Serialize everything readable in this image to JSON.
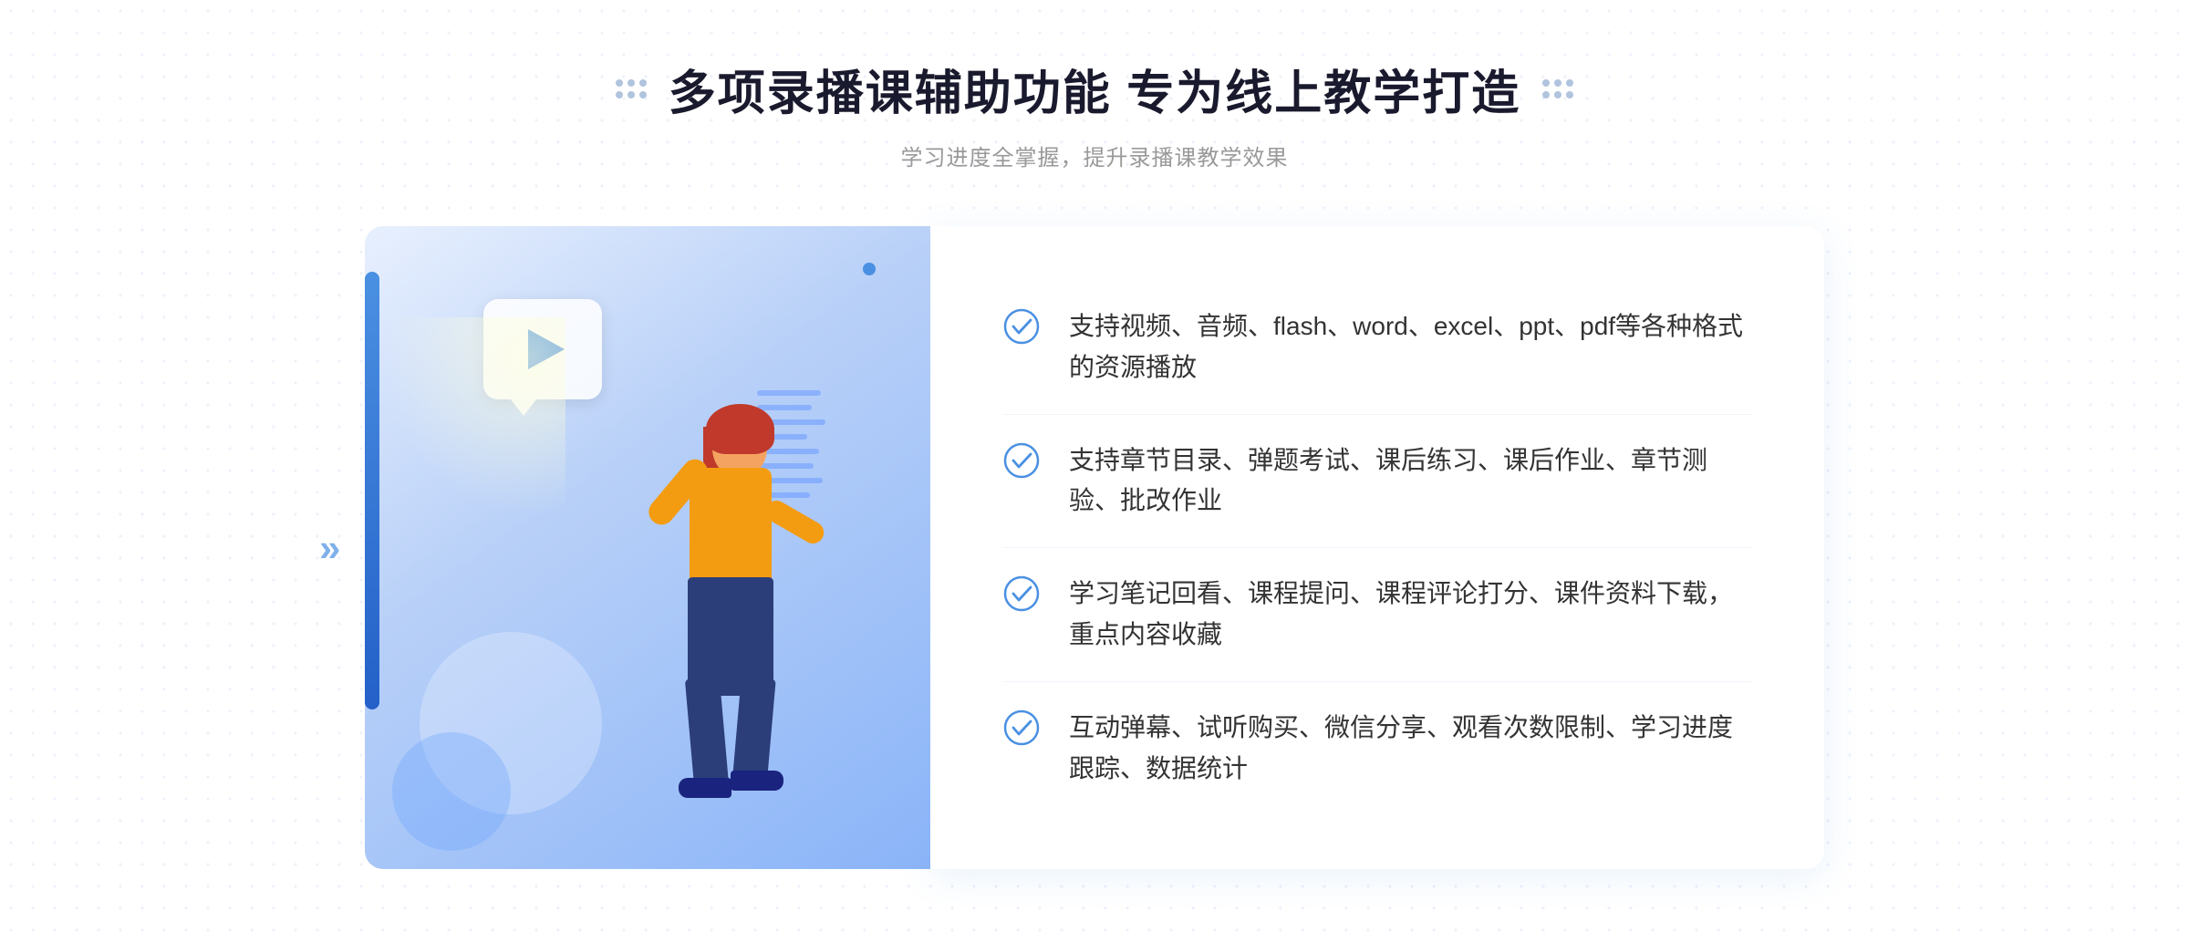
{
  "header": {
    "title": "多项录播课辅助功能 专为线上教学打造",
    "subtitle": "学习进度全掌握，提升录播课教学效果"
  },
  "decorative": {
    "left_arrows": "»"
  },
  "features": [
    {
      "id": 1,
      "text": "支持视频、音频、flash、word、excel、ppt、pdf等各种格式的资源播放"
    },
    {
      "id": 2,
      "text": "支持章节目录、弹题考试、课后练习、课后作业、章节测验、批改作业"
    },
    {
      "id": 3,
      "text": "学习笔记回看、课程提问、课程评论打分、课件资料下载，重点内容收藏"
    },
    {
      "id": 4,
      "text": "互动弹幕、试听购买、微信分享、观看次数限制、学习进度跟踪、数据统计"
    }
  ]
}
